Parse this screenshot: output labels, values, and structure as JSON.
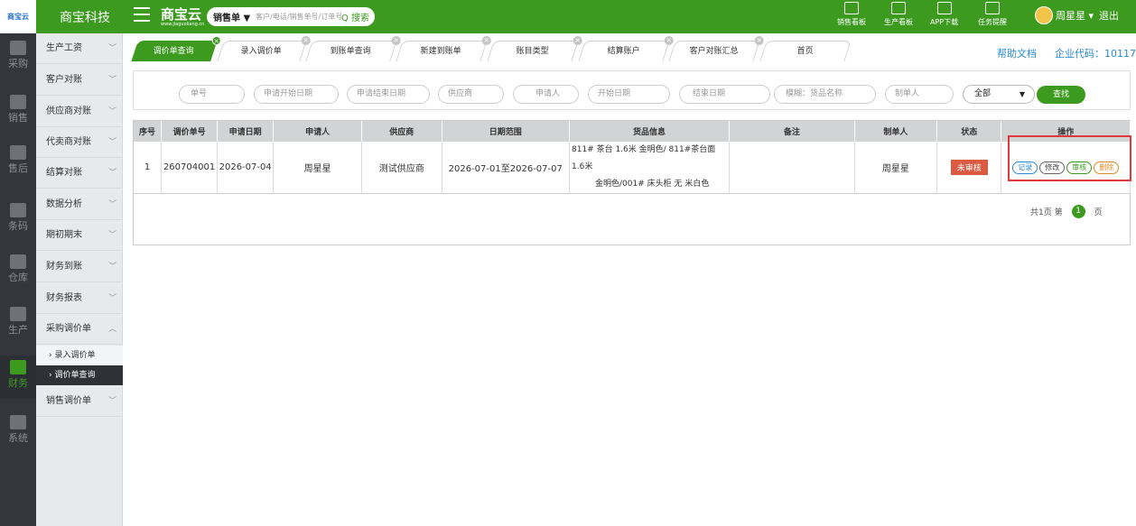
{
  "topbar": {
    "logo": "商宝云",
    "company": "商宝科技",
    "brand": "商宝云",
    "brand_sub": "www.jiaguoliang.cn",
    "search_type": "销售单 ▼",
    "search_placeholder": "客户/电话/销售单号/订单号",
    "search_button": "Q 搜索",
    "icons": [
      {
        "label": "销售看板",
        "icon": "chart-board-icon"
      },
      {
        "label": "生产看板",
        "icon": "trend-board-icon"
      },
      {
        "label": "APP下载",
        "icon": "qr-code-icon"
      },
      {
        "label": "任务提醒",
        "icon": "flag-icon"
      }
    ],
    "user": "周星星 ▾",
    "logout": "退出"
  },
  "iconbar": [
    {
      "label": "采购",
      "icon": "cart-icon"
    },
    {
      "label": "销售",
      "icon": "building-icon"
    },
    {
      "label": "售后",
      "icon": "building-icon"
    },
    {
      "label": "条码",
      "icon": "barcode-icon"
    },
    {
      "label": "仓库",
      "icon": "warehouse-icon"
    },
    {
      "label": "生产",
      "icon": "crane-icon"
    },
    {
      "label": "财务",
      "icon": "calculator-icon"
    },
    {
      "label": "系统",
      "icon": "gear-icon"
    }
  ],
  "sidebar": {
    "items": [
      {
        "label": "生产工资",
        "chev": "﹀"
      },
      {
        "label": "客户对账",
        "chev": "﹀"
      },
      {
        "label": "供应商对账",
        "chev": "﹀"
      },
      {
        "label": "代卖商对账",
        "chev": "﹀"
      },
      {
        "label": "结算对账",
        "chev": "﹀"
      },
      {
        "label": "数据分析",
        "chev": "﹀"
      },
      {
        "label": "期初期末",
        "chev": "﹀"
      },
      {
        "label": "财务到账",
        "chev": "﹀"
      },
      {
        "label": "财务报表",
        "chev": "﹀"
      },
      {
        "label": "采购调价单",
        "chev": "︿"
      }
    ],
    "subs": [
      {
        "label": "› 录入调价单"
      },
      {
        "label": "› 调价单查询"
      }
    ],
    "last": {
      "label": "销售调价单",
      "chev": "﹀"
    }
  },
  "tabs": [
    "调价单查询",
    "录入调价单",
    "到账单查询",
    "新建到账单",
    "账目类型",
    "结算账户",
    "客户对账汇总",
    "首页"
  ],
  "help": "帮助文档",
  "enterprise_code": "企业代码：10117",
  "filters": {
    "inputs": [
      "单号",
      "申请开始日期",
      "申请结束日期",
      "供应商",
      "申请人",
      "开始日期",
      "结束日期",
      "模糊：货品名称",
      "制单人"
    ],
    "select": "全部",
    "find_button": "查找"
  },
  "table": {
    "headers": [
      "序号",
      "调价单号",
      "申请日期",
      "申请人",
      "供应商",
      "日期范围",
      "货品信息",
      "备注",
      "制单人",
      "状态",
      "操作"
    ],
    "rows": [
      {
        "no": "1",
        "order_no": "260704001",
        "date": "2026-07-04",
        "applicant": "周星星",
        "supplier": "测试供应商",
        "range": "2026-07-01至2026-07-07",
        "goods_line1": "811# 茶台 1.6米 金明色/ 811#茶台面 1.6米",
        "goods_line2": "金明色/001# 床头柜 无 米白色",
        "remark": "",
        "creator": "周星星",
        "status": "未审核",
        "ops": {
          "record": "记录",
          "edit": "修改",
          "audit": "审核",
          "delete": "删除"
        }
      }
    ]
  },
  "pager": {
    "total": "共1页 第",
    "current": "1",
    "unit": "页"
  },
  "colors": {
    "green": "#3c9a1f",
    "red_box": "#e0383b",
    "status_red": "#dd5a42"
  }
}
